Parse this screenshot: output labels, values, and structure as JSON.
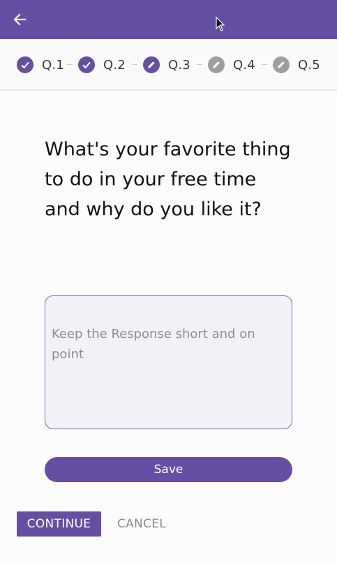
{
  "colors": {
    "primary": "#654fa4",
    "step_pending": "#9e9e9e",
    "placeholder_text": "#8e8e8e",
    "answer_border": "#7a68b8"
  },
  "header": {
    "back_icon": "arrow-left-icon"
  },
  "stepper": {
    "steps": [
      {
        "label": "Q.1",
        "state": "completed",
        "icon": "check-icon"
      },
      {
        "label": "Q.2",
        "state": "completed",
        "icon": "check-icon"
      },
      {
        "label": "Q.3",
        "state": "active",
        "icon": "pencil-icon"
      },
      {
        "label": "Q.4",
        "state": "pending",
        "icon": "pencil-icon"
      },
      {
        "label": "Q.5",
        "state": "pending",
        "icon": "pencil-icon"
      }
    ]
  },
  "question": {
    "text": "What's your favorite thing to do in your free time and why do you like it?"
  },
  "answer": {
    "value": "",
    "placeholder": "Keep the Response short and on point"
  },
  "actions": {
    "save_label": "Save",
    "continue_label": "CONTINUE",
    "cancel_label": "CANCEL"
  }
}
